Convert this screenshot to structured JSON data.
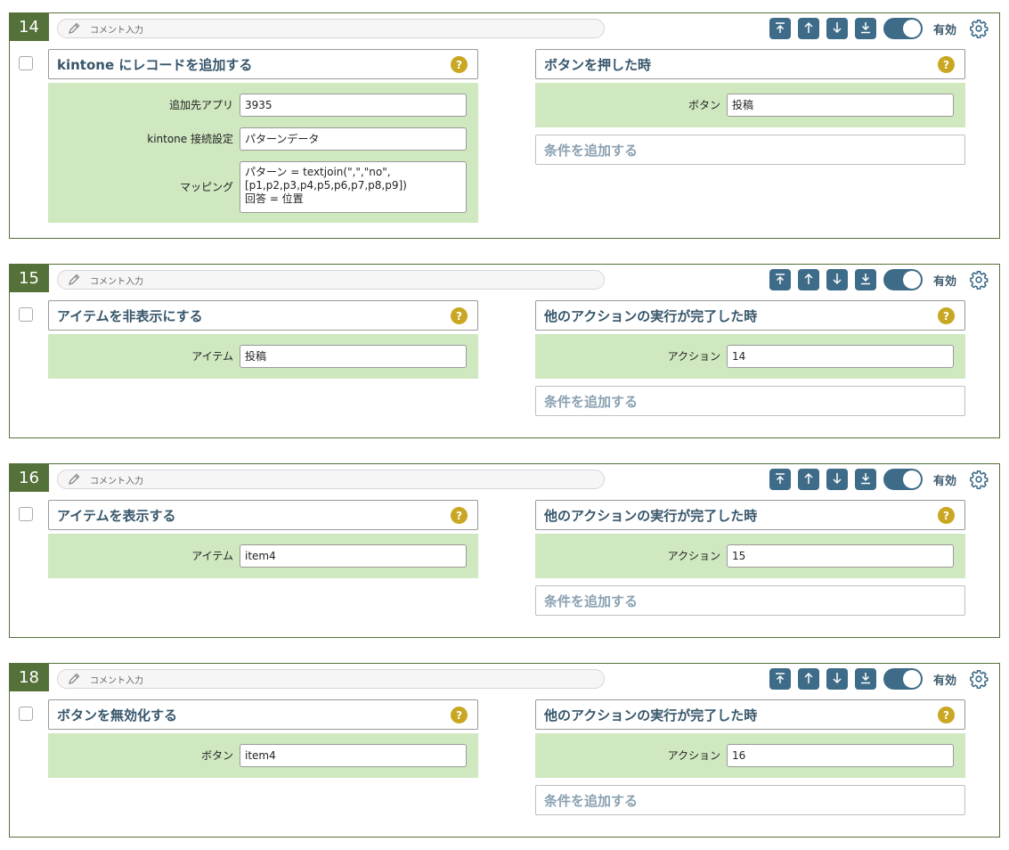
{
  "common": {
    "comment_placeholder": "コメント入力",
    "enabled_label": "有効",
    "help_label": "?",
    "add_condition_label": "条件を追加する"
  },
  "colors": {
    "card_border": "#55713a",
    "accent": "#3d6b88",
    "field_bg": "#cfe8c0",
    "help": "#c9a722"
  },
  "icons": {
    "comment": "pencil-icon",
    "move_top": "arrow-to-top-icon",
    "move_up": "arrow-up-icon",
    "move_down": "arrow-down-icon",
    "move_bottom": "arrow-to-bottom-icon",
    "settings": "gear-icon",
    "help": "question-icon"
  },
  "rules": [
    {
      "number": "14",
      "action": {
        "title": "kintone にレコードを追加する",
        "fields": [
          {
            "label": "追加先アプリ",
            "value": "3935"
          },
          {
            "label": "kintone 接続設定",
            "value": "パターンデータ"
          },
          {
            "label": "マッピング",
            "lines": [
              "パターン = textjoin(\",\",\"no\",",
              "[p1,p2,p3,p4,p5,p6,p7,p8,p9])",
              "回答 = 位置"
            ]
          }
        ]
      },
      "trigger": {
        "title": "ボタンを押した時",
        "fields": [
          {
            "label": "ボタン",
            "value": "投稿"
          }
        ]
      }
    },
    {
      "number": "15",
      "action": {
        "title": "アイテムを非表示にする",
        "fields": [
          {
            "label": "アイテム",
            "value": "投稿"
          }
        ]
      },
      "trigger": {
        "title": "他のアクションの実行が完了した時",
        "fields": [
          {
            "label": "アクション",
            "value": "14"
          }
        ]
      }
    },
    {
      "number": "16",
      "action": {
        "title": "アイテムを表示する",
        "fields": [
          {
            "label": "アイテム",
            "value": "item4"
          }
        ]
      },
      "trigger": {
        "title": "他のアクションの実行が完了した時",
        "fields": [
          {
            "label": "アクション",
            "value": "15"
          }
        ]
      }
    },
    {
      "number": "18",
      "action": {
        "title": "ボタンを無効化する",
        "fields": [
          {
            "label": "ボタン",
            "value": "item4"
          }
        ]
      },
      "trigger": {
        "title": "他のアクションの実行が完了した時",
        "fields": [
          {
            "label": "アクション",
            "value": "16"
          }
        ]
      }
    }
  ]
}
